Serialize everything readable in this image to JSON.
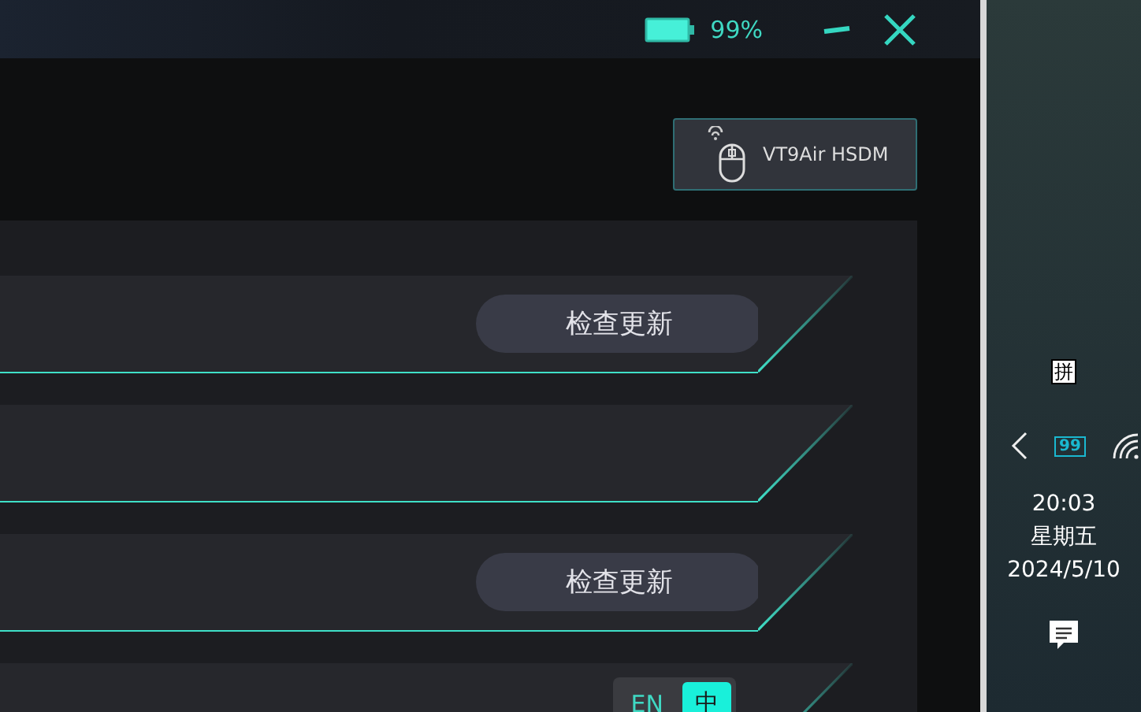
{
  "title_bar": {
    "battery_text": "99%"
  },
  "device_button": {
    "label": "VT9Air HSDM"
  },
  "rows": [
    {
      "kind": "update",
      "button": "检查更新"
    },
    {
      "kind": "blank"
    },
    {
      "kind": "update",
      "button": "检查更新"
    },
    {
      "kind": "language",
      "options": [
        {
          "label": "EN",
          "selected": false
        },
        {
          "label": "中",
          "selected": true
        }
      ]
    }
  ],
  "taskbar": {
    "ime": "拼",
    "battery_text": "99",
    "time": "20:03",
    "weekday": "星期五",
    "date": "2024/5/10"
  }
}
